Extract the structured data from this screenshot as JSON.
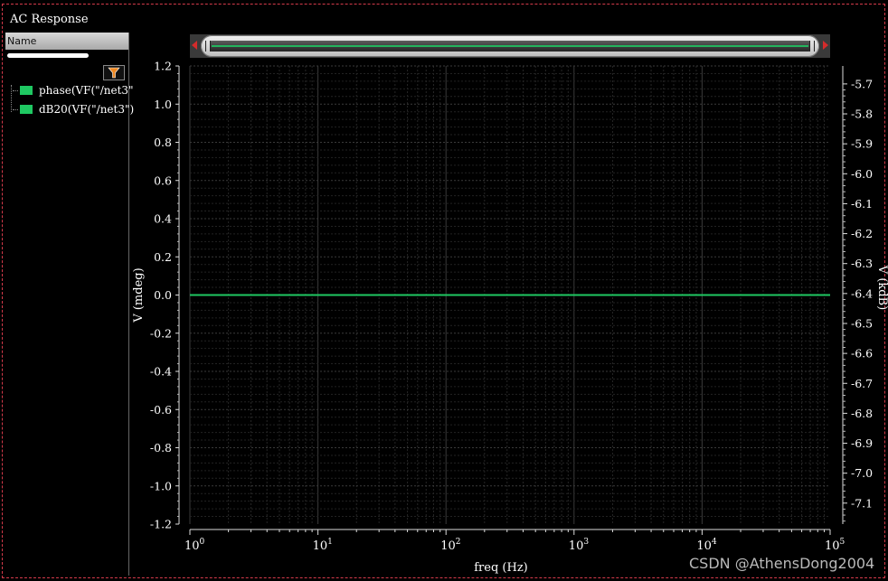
{
  "window": {
    "title": "AC Response"
  },
  "panel": {
    "column_header": "Name",
    "signals": [
      {
        "label": "phase(VF(\"/net3\"",
        "color": "#1fc862"
      },
      {
        "label": "dB20(VF(\"/net3\")",
        "color": "#1fc862"
      }
    ]
  },
  "watermark": "CSDN @AthensDong2004",
  "chart_data": {
    "type": "line",
    "xlabel": "freq (Hz)",
    "ylabel_left": "V (mdeg)",
    "ylabel_right": "V (kdB)",
    "x_scale": "log",
    "xlim": [
      1,
      100000
    ],
    "x_ticks": [
      {
        "base": "10",
        "exp": "0"
      },
      {
        "base": "10",
        "exp": "1"
      },
      {
        "base": "10",
        "exp": "2"
      },
      {
        "base": "10",
        "exp": "3"
      },
      {
        "base": "10",
        "exp": "4"
      },
      {
        "base": "10",
        "exp": "5"
      }
    ],
    "y_left": {
      "lim": [
        -1.2,
        1.2
      ],
      "ticks": [
        "1.2",
        "1.0",
        "0.8",
        "0.6",
        "0.4",
        "0.2",
        "0.0",
        "-0.2",
        "-0.4",
        "-0.6",
        "-0.8",
        "-1.0",
        "-1.2"
      ]
    },
    "y_right": {
      "lim": [
        -7.17,
        -5.64
      ],
      "ticks": [
        "-5.7",
        "-5.8",
        "-5.9",
        "-6.0",
        "-6.1",
        "-6.2",
        "-6.3",
        "-6.4",
        "-6.5",
        "-6.6",
        "-6.7",
        "-6.8",
        "-6.9",
        "-7.0",
        "-7.1"
      ]
    },
    "grid": true,
    "series": [
      {
        "name": "phase(VF(\"/net3\"",
        "axis": "left",
        "x": [
          1,
          100000
        ],
        "y": [
          0.0,
          0.0
        ],
        "color": "#1fc862"
      }
    ]
  }
}
